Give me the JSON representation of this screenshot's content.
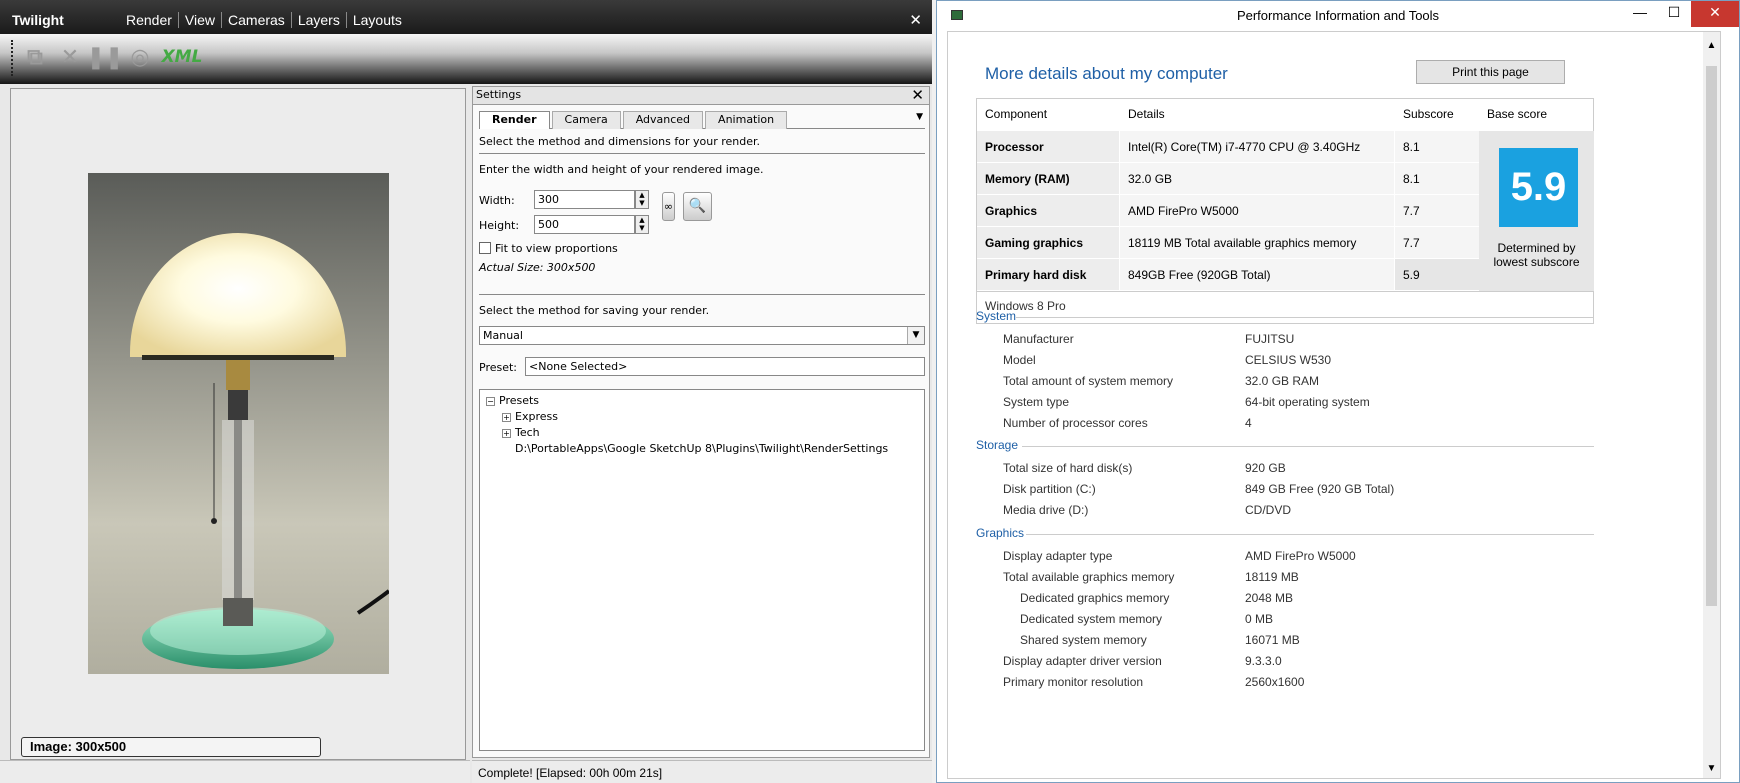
{
  "twilight": {
    "title": "Twilight",
    "menu": [
      "Render",
      "View",
      "Cameras",
      "Layers",
      "Layouts"
    ],
    "close": "✕",
    "toolbar": {
      "xml": "XML"
    },
    "image_status": "Image: 300x500",
    "status": "Complete!  [Elapsed: 00h 00m 21s]"
  },
  "settings": {
    "title": "Settings",
    "close": "✕",
    "tabs": [
      "Render",
      "Camera",
      "Advanced",
      "Animation"
    ],
    "tab_menu": "▼",
    "intro": "Select the method and dimensions for your render.",
    "dims_prompt": "Enter the width and height of your rendered image.",
    "width_label": "Width:",
    "width_value": "300",
    "height_label": "Height:",
    "height_value": "500",
    "fit_label": "Fit to view proportions",
    "actual_size": "Actual Size: 300x500",
    "save_prompt": "Select the method for saving your render.",
    "save_method": "Manual",
    "preset_label": "Preset:",
    "preset_value": "<None Selected>",
    "tree": {
      "root": "Presets",
      "children": [
        "Express",
        "Tech"
      ],
      "path": "D:\\PortableApps\\Google SketchUp 8\\Plugins\\Twilight\\RenderSettings"
    }
  },
  "perf": {
    "window_title": "Performance Information and Tools",
    "heading": "More details about my computer",
    "print_button": "Print this page",
    "table": {
      "headers": [
        "Component",
        "Details",
        "Subscore",
        "Base score"
      ],
      "rows": [
        {
          "component": "Processor",
          "details": "Intel(R) Core(TM) i7-4770 CPU @ 3.40GHz",
          "subscore": "8.1"
        },
        {
          "component": "Memory (RAM)",
          "details": "32.0 GB",
          "subscore": "8.1"
        },
        {
          "component": "Graphics",
          "details": "AMD FirePro W5000",
          "subscore": "7.7"
        },
        {
          "component": "Gaming graphics",
          "details": "18119 MB Total available graphics memory",
          "subscore": "7.7"
        },
        {
          "component": "Primary hard disk",
          "details": "849GB Free (920GB Total)",
          "subscore": "5.9"
        }
      ],
      "base_score": "5.9",
      "determined_by": "Determined by lowest subscore",
      "os": "Windows 8 Pro"
    },
    "system": {
      "title": "System",
      "items": [
        {
          "k": "Manufacturer",
          "v": "FUJITSU"
        },
        {
          "k": "Model",
          "v": "CELSIUS W530"
        },
        {
          "k": "Total amount of system memory",
          "v": "32.0 GB RAM"
        },
        {
          "k": "System type",
          "v": "64-bit operating system"
        },
        {
          "k": "Number of processor cores",
          "v": "4"
        }
      ]
    },
    "storage": {
      "title": "Storage",
      "items": [
        {
          "k": "Total size of hard disk(s)",
          "v": "920 GB"
        },
        {
          "k": "Disk partition (C:)",
          "v": "849 GB Free (920 GB Total)"
        },
        {
          "k": "Media drive (D:)",
          "v": "CD/DVD"
        }
      ]
    },
    "graphics": {
      "title": "Graphics",
      "items": [
        {
          "k": "Display adapter type",
          "v": "AMD FirePro W5000"
        },
        {
          "k": "Total available graphics memory",
          "v": "18119 MB"
        },
        {
          "k": "Dedicated graphics memory",
          "v": "2048 MB"
        },
        {
          "k": "Dedicated system memory",
          "v": "0 MB"
        },
        {
          "k": "Shared system memory",
          "v": "16071 MB"
        },
        {
          "k": "Display adapter driver version",
          "v": "9.3.3.0"
        },
        {
          "k": "Primary monitor resolution",
          "v": "2560x1600"
        }
      ]
    }
  },
  "colors": {
    "accent": "#1e5fa6",
    "score_tile": "#1aa1e0",
    "close_red": "#c7372f"
  }
}
